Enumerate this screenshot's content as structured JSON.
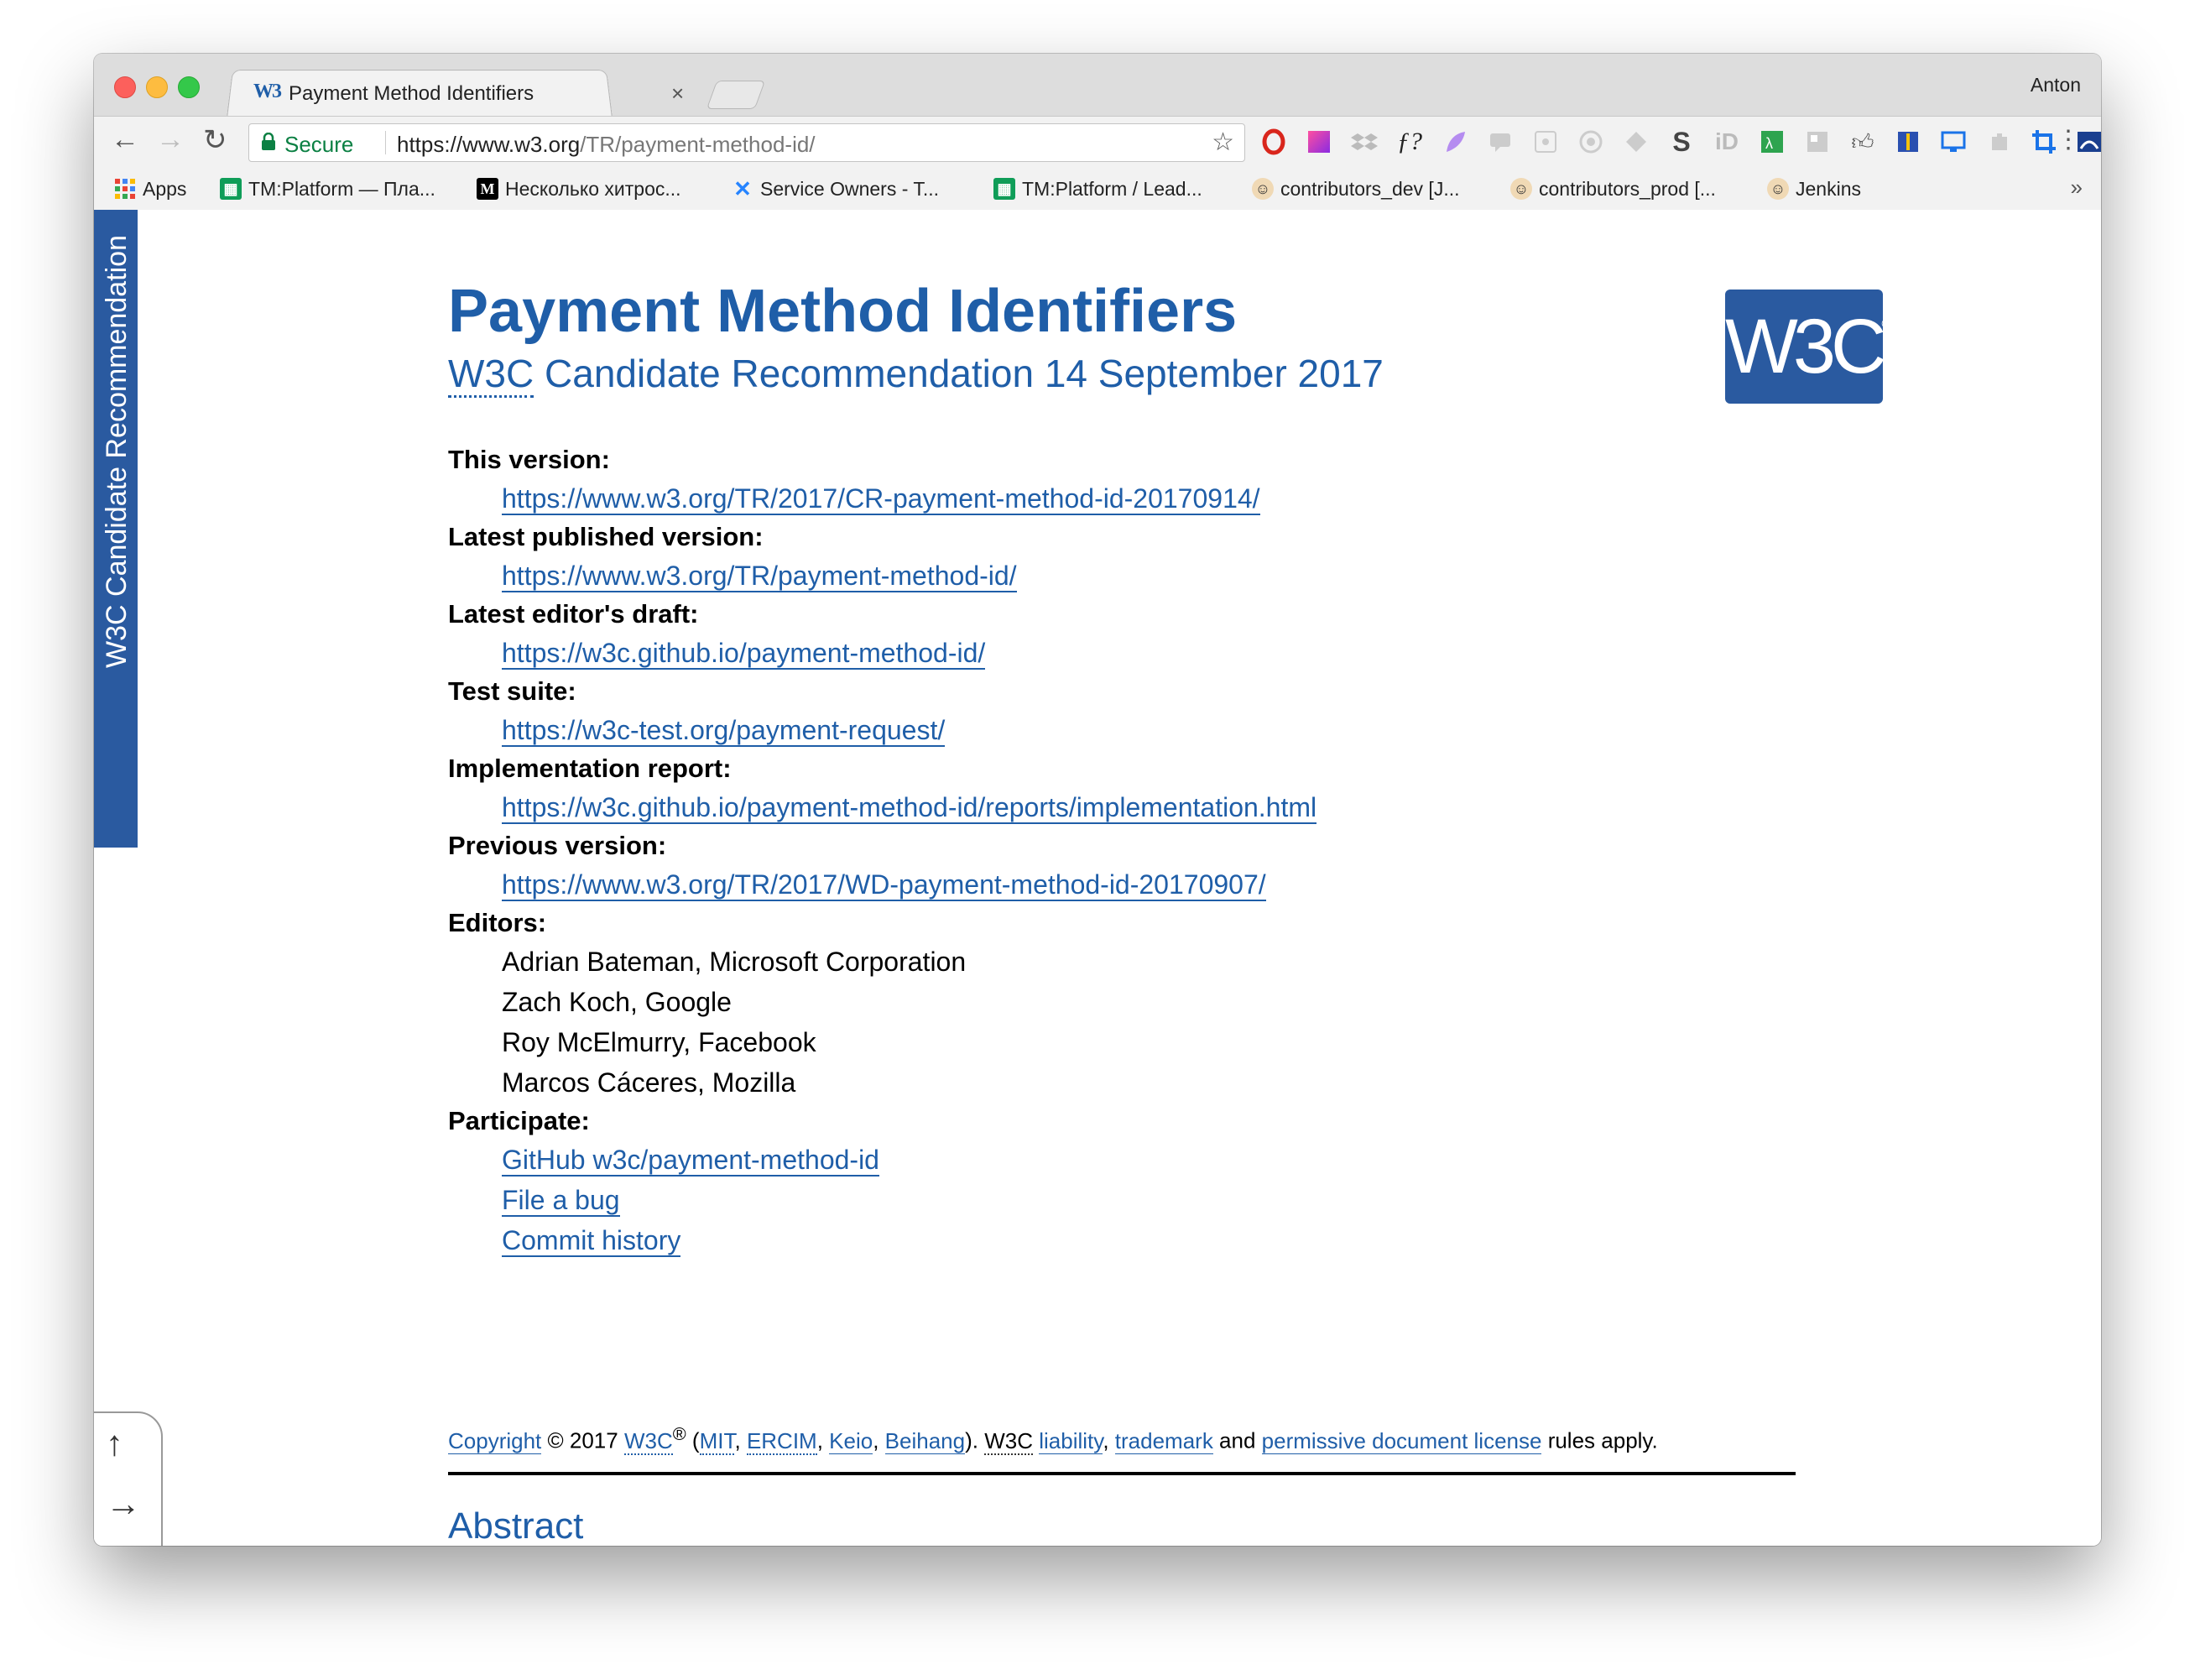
{
  "browser": {
    "tab_title": "Payment Method Identifiers",
    "tab_favicon_text": "W3",
    "tab_close": "×",
    "profile_name": "Anton",
    "secure_label": "Secure",
    "url_host": "https://www.w3.org",
    "url_path": "/TR/payment-method-id/",
    "back_icon": "←",
    "forward_icon": "→",
    "reload_icon": "↻",
    "star_icon": "☆",
    "menu_icon": "⋮",
    "bookmarks_more": "»"
  },
  "bookmarks": [
    {
      "label": "Apps",
      "icon": "apps-grid-icon"
    },
    {
      "label": "TM:Platform — Пла...",
      "icon": "sheets-icon"
    },
    {
      "label": "Несколько хитрос...",
      "icon": "medium-icon"
    },
    {
      "label": "Service Owners - T...",
      "icon": "confluence-icon"
    },
    {
      "label": "TM:Platform / Lead...",
      "icon": "sheets-icon"
    },
    {
      "label": "contributors_dev [J...",
      "icon": "jenkins-icon"
    },
    {
      "label": "contributors_prod [...",
      "icon": "jenkins-icon"
    },
    {
      "label": "Jenkins",
      "icon": "jenkins-icon"
    }
  ],
  "sidebar_status": "W3C Candidate Recommendation",
  "doc": {
    "title": "Payment Method Identifiers",
    "subtitle_abbr": "W3C",
    "subtitle_rest": " Candidate Recommendation 14 September 2017",
    "logo_text": "W3C",
    "logo_reg": "®",
    "this_version_label": "This version:",
    "this_version_url": "https://www.w3.org/TR/2017/CR-payment-method-id-20170914/",
    "latest_published_label": "Latest published version:",
    "latest_published_url": "https://www.w3.org/TR/payment-method-id/",
    "latest_draft_label": "Latest editor's draft:",
    "latest_draft_url": "https://w3c.github.io/payment-method-id/",
    "test_suite_label": "Test suite:",
    "test_suite_url": "https://w3c-test.org/payment-request/",
    "impl_report_label": "Implementation report:",
    "impl_report_url": "https://w3c.github.io/payment-method-id/reports/implementation.html",
    "previous_version_label": "Previous version:",
    "previous_version_url": "https://www.w3.org/TR/2017/WD-payment-method-id-20170907/",
    "editors_label": "Editors:",
    "editors": [
      "Adrian Bateman, Microsoft Corporation",
      "Zach Koch, Google",
      "Roy McElmurry, Facebook",
      "Marcos Cáceres, Mozilla"
    ],
    "participate_label": "Participate:",
    "participate": [
      "GitHub w3c/payment-method-id",
      "File a bug",
      "Commit history"
    ],
    "abstract_heading": "Abstract"
  },
  "copyright": {
    "copyright_link": "Copyright",
    "year": " © 2017 ",
    "w3c": "W3C",
    "reg": "®",
    "open_paren": " (",
    "mit": "MIT",
    "sep1": ", ",
    "ercim": "ERCIM",
    "sep2": ", ",
    "keio": "Keio",
    "sep3": ", ",
    "beihang": "Beihang",
    "close_paren": "). ",
    "w3c2": "W3C",
    "space": " ",
    "liability": "liability",
    "sep4": ", ",
    "trademark": "trademark",
    "and": " and ",
    "license": "permissive document license",
    "rules": " rules apply."
  },
  "toc_toggle": {
    "up": "↑",
    "right": "→"
  }
}
